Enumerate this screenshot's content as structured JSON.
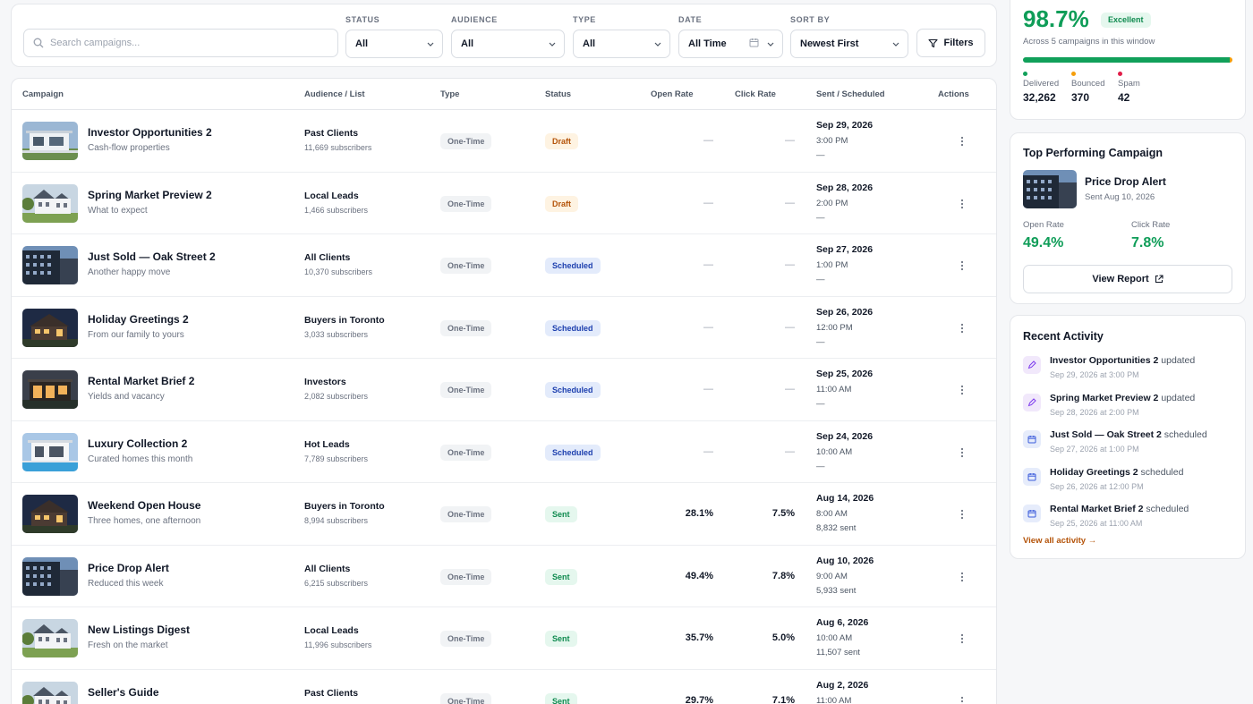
{
  "search": {
    "placeholder": "Search campaigns..."
  },
  "filters": {
    "status": {
      "label": "STATUS",
      "value": "All"
    },
    "audience": {
      "label": "AUDIENCE",
      "value": "All"
    },
    "type": {
      "label": "TYPE",
      "value": "All"
    },
    "date": {
      "label": "DATE",
      "value": "All Time"
    },
    "sort": {
      "label": "SORT BY",
      "value": "Newest First"
    },
    "filters_button": "Filters"
  },
  "table": {
    "headers": {
      "campaign": "Campaign",
      "audience": "Audience / List",
      "type": "Type",
      "status": "Status",
      "open_rate": "Open Rate",
      "click_rate": "Click Rate",
      "sent": "Sent / Scheduled",
      "actions": "Actions"
    },
    "rows": [
      {
        "name": "Investor Opportunities 2",
        "sub": "Cash-flow properties",
        "audience": "Past Clients",
        "subscribers": "11,669 subscribers",
        "type": "One-Time",
        "status": "Draft",
        "status_key": "draft",
        "open": "—",
        "click": "—",
        "date": "Sep 29, 2026",
        "time": "3:00 PM",
        "sent": "—",
        "thumb": "modern-white"
      },
      {
        "name": "Spring Market Preview 2",
        "sub": "What to expect",
        "audience": "Local Leads",
        "subscribers": "1,466 subscribers",
        "type": "One-Time",
        "status": "Draft",
        "status_key": "draft",
        "open": "—",
        "click": "—",
        "date": "Sep 28, 2026",
        "time": "2:00 PM",
        "sent": "—",
        "thumb": "victorian"
      },
      {
        "name": "Just Sold — Oak Street 2",
        "sub": "Another happy move",
        "audience": "All Clients",
        "subscribers": "10,370 subscribers",
        "type": "One-Time",
        "status": "Scheduled",
        "status_key": "scheduled",
        "open": "—",
        "click": "—",
        "date": "Sep 27, 2026",
        "time": "1:00 PM",
        "sent": "—",
        "thumb": "dark-building"
      },
      {
        "name": "Holiday Greetings 2",
        "sub": "From our family to yours",
        "audience": "Buyers in Toronto",
        "subscribers": "3,033 subscribers",
        "type": "One-Time",
        "status": "Scheduled",
        "status_key": "scheduled",
        "open": "—",
        "click": "—",
        "date": "Sep 26, 2026",
        "time": "12:00 PM",
        "sent": "—",
        "thumb": "night-house"
      },
      {
        "name": "Rental Market Brief 2",
        "sub": "Yields and vacancy",
        "audience": "Investors",
        "subscribers": "2,082 subscribers",
        "type": "One-Time",
        "status": "Scheduled",
        "status_key": "scheduled",
        "open": "—",
        "click": "—",
        "date": "Sep 25, 2026",
        "time": "11:00 AM",
        "sent": "—",
        "thumb": "dusk-modern"
      },
      {
        "name": "Luxury Collection 2",
        "sub": "Curated homes this month",
        "audience": "Hot Leads",
        "subscribers": "7,789 subscribers",
        "type": "One-Time",
        "status": "Scheduled",
        "status_key": "scheduled",
        "open": "—",
        "click": "—",
        "date": "Sep 24, 2026",
        "time": "10:00 AM",
        "sent": "—",
        "thumb": "pool-villa"
      },
      {
        "name": "Weekend Open House",
        "sub": "Three homes, one afternoon",
        "audience": "Buyers in Toronto",
        "subscribers": "8,994 subscribers",
        "type": "One-Time",
        "status": "Sent",
        "status_key": "sent",
        "open": "28.1%",
        "click": "7.5%",
        "date": "Aug 14, 2026",
        "time": "8:00 AM",
        "sent": "8,832 sent",
        "thumb": "night-house"
      },
      {
        "name": "Price Drop Alert",
        "sub": "Reduced this week",
        "audience": "All Clients",
        "subscribers": "6,215 subscribers",
        "type": "One-Time",
        "status": "Sent",
        "status_key": "sent",
        "open": "49.4%",
        "click": "7.8%",
        "date": "Aug 10, 2026",
        "time": "9:00 AM",
        "sent": "5,933 sent",
        "thumb": "dark-building"
      },
      {
        "name": "New Listings Digest",
        "sub": "Fresh on the market",
        "audience": "Local Leads",
        "subscribers": "11,996 subscribers",
        "type": "One-Time",
        "status": "Sent",
        "status_key": "sent",
        "open": "35.7%",
        "click": "5.0%",
        "date": "Aug 6, 2026",
        "time": "10:00 AM",
        "sent": "11,507 sent",
        "thumb": "victorian"
      },
      {
        "name": "Seller's Guide",
        "sub": "",
        "audience": "Past Clients",
        "subscribers": "",
        "type": "One-Time",
        "status": "Sent",
        "status_key": "sent",
        "open": "29.7%",
        "click": "7.1%",
        "date": "Aug 2, 2026",
        "time": "11:00 AM",
        "sent": "",
        "thumb": "victorian"
      }
    ]
  },
  "deliverability": {
    "rate": "98.7%",
    "badge": "Excellent",
    "caption": "Across 5 campaigns in this window",
    "bar": {
      "delivered": 0.987,
      "bounced": 0.0113,
      "spam": 0.0013
    },
    "colors": {
      "delivered": "#11a05a",
      "bounced": "#f59e0b",
      "spam": "#e11d48"
    },
    "stats": [
      {
        "label": "Delivered",
        "value": "32,262"
      },
      {
        "label": "Bounced",
        "value": "370"
      },
      {
        "label": "Spam",
        "value": "42"
      }
    ]
  },
  "top_campaign": {
    "title": "Top Performing Campaign",
    "name": "Price Drop Alert",
    "sent": "Sent Aug 10, 2026",
    "open_label": "Open Rate",
    "open_value": "49.4%",
    "click_label": "Click Rate",
    "click_value": "7.8%",
    "button": "View Report"
  },
  "recent_activity": {
    "title": "Recent Activity",
    "items": [
      {
        "name": "Investor Opportunities 2",
        "action": "updated",
        "time": "Sep 29, 2026 at 3:00 PM",
        "icon": "edit"
      },
      {
        "name": "Spring Market Preview 2",
        "action": "updated",
        "time": "Sep 28, 2026 at 2:00 PM",
        "icon": "edit"
      },
      {
        "name": "Just Sold — Oak Street 2",
        "action": "scheduled",
        "time": "Sep 27, 2026 at 1:00 PM",
        "icon": "calendar"
      },
      {
        "name": "Holiday Greetings 2",
        "action": "scheduled",
        "time": "Sep 26, 2026 at 12:00 PM",
        "icon": "calendar"
      },
      {
        "name": "Rental Market Brief 2",
        "action": "scheduled",
        "time": "Sep 25, 2026 at 11:00 AM",
        "icon": "calendar"
      }
    ],
    "view_all": "View all activity →"
  }
}
